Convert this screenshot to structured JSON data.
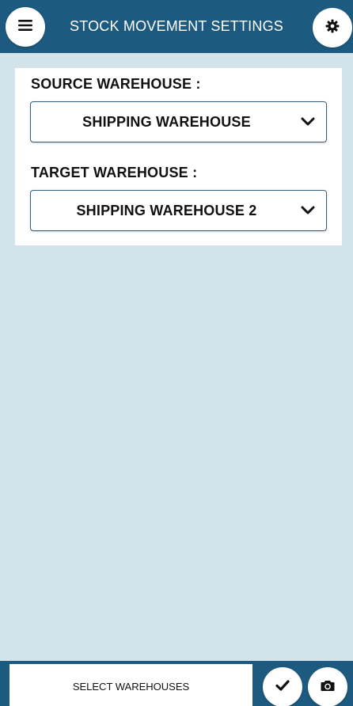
{
  "header": {
    "title": "STOCK MOVEMENT SETTINGS",
    "left_icon": "menu-icon",
    "right_icon": "gear-icon"
  },
  "settings": {
    "source": {
      "label": "SOURCE WAREHOUSE :",
      "selected": "SHIPPING WAREHOUSE"
    },
    "target": {
      "label": "TARGET WAREHOUSE :",
      "selected": "SHIPPING WAREHOUSE 2"
    }
  },
  "footer": {
    "status": "SELECT WAREHOUSES",
    "confirm_icon": "check-icon",
    "camera_icon": "camera-icon"
  },
  "colors": {
    "header_bg": "#1d5a7f",
    "page_bg": "#d3e3ec",
    "panel_bg": "#ffffff",
    "select_border": "#3a5f7c"
  }
}
